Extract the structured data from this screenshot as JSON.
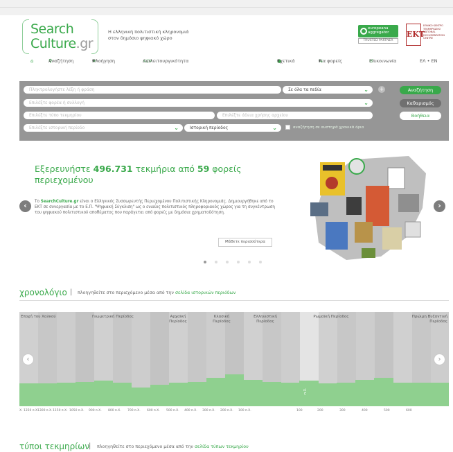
{
  "brand": {
    "line1": "Search",
    "line2": "Culture",
    "line2_suffix": ".gr",
    "tagline1": "Η ελληνική πολιτιστική κληρονομιά",
    "tagline2": "στον δημόσιο ψηφιακό χώρο"
  },
  "partners": {
    "europeana_line1": "europeana",
    "europeana_line2": "aggregator",
    "trusted": "TRUSTED PARTNER",
    "ekt_mark": "ΕΚΤ",
    "ekt_text1": "ΕΘΝΙΚΟ ΚΕΝΤΡΟ",
    "ekt_text2": "ΤΕΚΜΗΡΙΩΣΗΣ",
    "ekt_text3": "NATIONAL",
    "ekt_text4": "DOCUMENTATION",
    "ekt_text5": "CENTRE"
  },
  "nav": {
    "home_icon": "home-icon",
    "search": "Αναζήτηση",
    "browse": "Πλοήγηση",
    "dev": "Διαλειτουργικότητα",
    "about": "Σχετικά",
    "providers": "Για φορείς",
    "contact": "Επικοινωνία",
    "lang": "ΕΛ • EN"
  },
  "search": {
    "keyword_placeholder": "Πληκτρολογήστε λέξη ή φράση",
    "field_select": "Σε όλα τα πεδία",
    "provider_placeholder": "Επιλέξτε φορέα ή συλλογή",
    "type_placeholder": "Επιλέξτε τύπο τεκμηρίου",
    "rights_placeholder": "Επιλέξτε άδεια χρήσης αρχείου",
    "period_placeholder": "Επιλέξτε ιστορική περίοδο",
    "period_select": "Ιστορική περίοδος",
    "strict_label": "αναζήτηση σε αυστηρά χρονικά όρια",
    "search_btn": "Αναζήτηση",
    "clear_btn": "Καθαρισμός",
    "help_btn": "Βοήθεια"
  },
  "hero": {
    "title_pre": "Εξερευνήστε",
    "title_count": "496.731",
    "title_mid": "τεκμήρια από",
    "title_providers": "59",
    "title_post": "φορείς περιεχομένου",
    "text_pre": "Το",
    "text_link": "SearchCulture.gr",
    "text_body": "είναι ο Ελληνικός Συσσωρευτής Περιεχομένου Πολιτιστικής Κληρονομιάς. Δημιουργήθηκε από το ΕΚΤ σε συνεργασία με το Ε.Π. \"Ψηφιακή Σύγκλιση\" ως ο ενιαίος πολιτιστικός πληροφοριακός χώρος για τη συγκέντρωση του ψηφιακού πολιτιστικού αποθέματος που παράγεται από φορείς με δημόσια χρηματοδότηση.",
    "more": "Μάθετε περισσότερα",
    "prev_icon": "chevron-left-icon",
    "next_icon": "chevron-right-icon",
    "slides": 6,
    "active_slide": 1
  },
  "chronology": {
    "title": "χρονολόγιο",
    "sub_pre": "πλοηγηθείτε στο περιεχόμενο μέσα από την",
    "sub_link": "σελίδα ιστορικών περιόδων",
    "periods": [
      "Εποχή του Χαλκού",
      "Γεωμετρική Περίοδος",
      "Αρχαϊκή Περίοδος",
      "Κλασική Περίοδος",
      "Ελληνιστική Περίοδος",
      "Ρωμαϊκή Περίοδος",
      "Πρώιμη Βυζαντινή Περίοδος"
    ],
    "era_label": "π.Χ.",
    "axis": [
      "Χ. 1350 π.Χ.",
      "1300 π.Χ.",
      "1150 π.Χ.",
      "1050 π.Χ.",
      "900 π.Χ.",
      "800 π.Χ.",
      "700 π.Χ.",
      "600 π.Χ.",
      "500 π.Χ.",
      "400 π.Χ.",
      "300 π.Χ.",
      "200 π.Χ.",
      "100 π.Χ.",
      "100",
      "200",
      "300",
      "400",
      "500",
      "600"
    ],
    "bar_levels": [
      0.24,
      0.24,
      0.25,
      0.26,
      0.27,
      0.25,
      0.2,
      0.23,
      0.25,
      0.26,
      0.3,
      0.34,
      0.28,
      0.26,
      0.25,
      0.27,
      0.24,
      0.25,
      0.28,
      0.3,
      0.25,
      0.25,
      0.25
    ]
  },
  "types": {
    "title": "τύποι τεκμηρίων",
    "sub_pre": "πλοηγηθείτε στο περιεχόμενο μέσα από την",
    "sub_link": "σελίδα τύπων τεκμηρίου"
  }
}
